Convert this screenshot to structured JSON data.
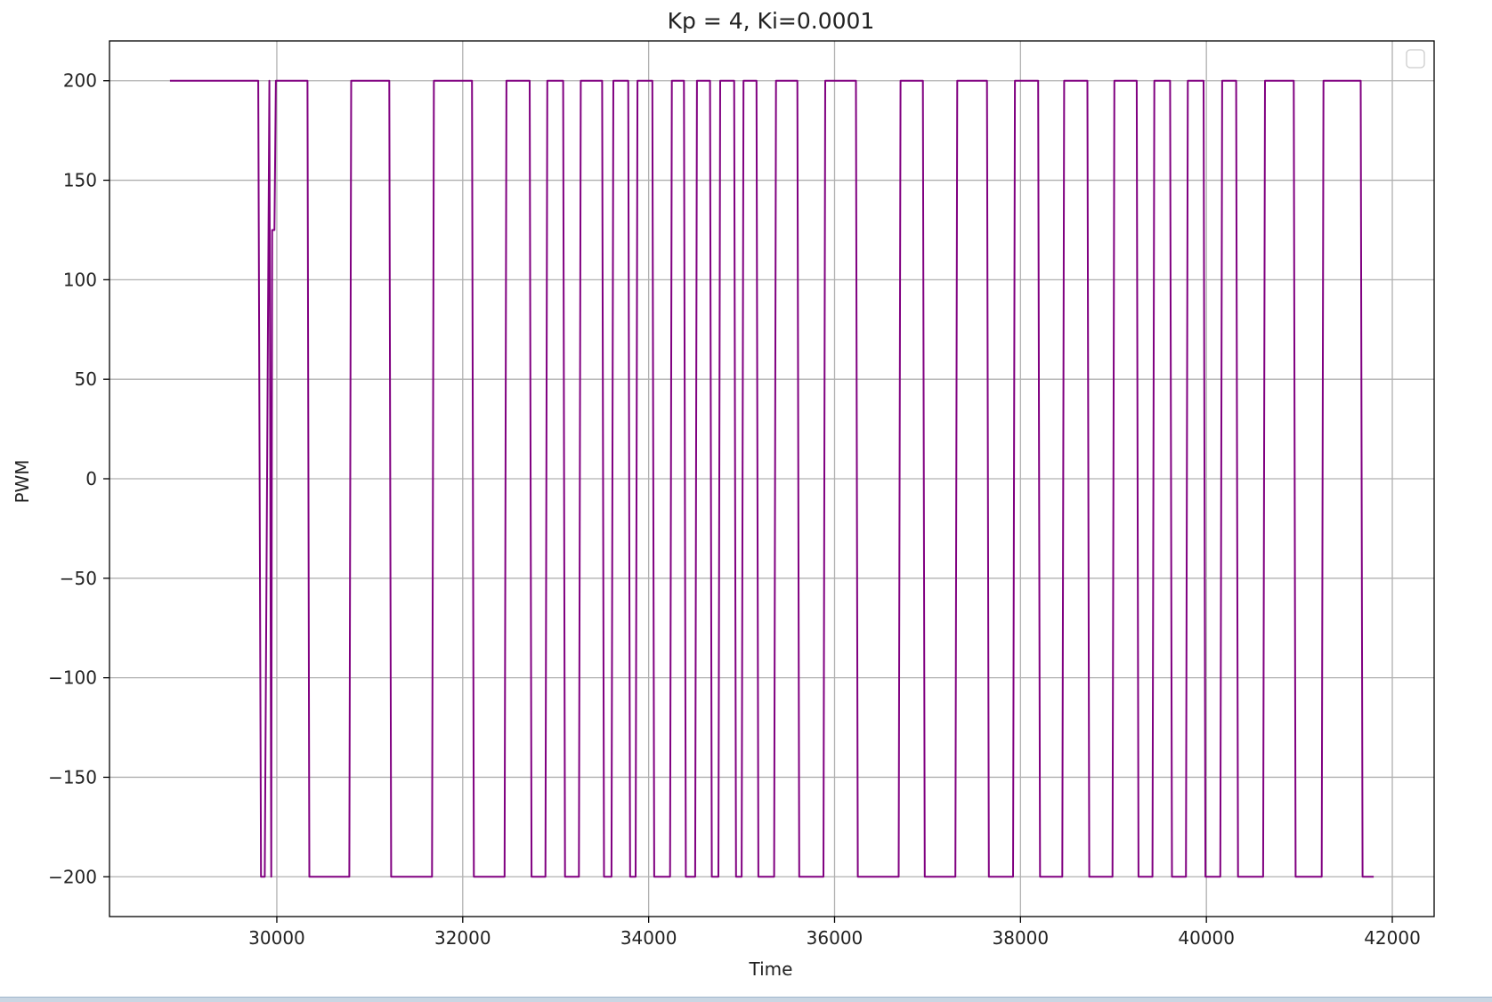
{
  "chart_data": {
    "type": "line",
    "title": "Kp = 4, Ki=0.0001",
    "xlabel": "Time",
    "ylabel": "PWM",
    "xlim": [
      28200,
      42450
    ],
    "ylim": [
      -220,
      220
    ],
    "xticks": [
      30000,
      32000,
      34000,
      36000,
      38000,
      40000,
      42000
    ],
    "yticks": [
      -200,
      -150,
      -100,
      -50,
      0,
      50,
      100,
      150,
      200
    ],
    "xtick_labels": [
      "30000",
      "32000",
      "34000",
      "36000",
      "38000",
      "40000",
      "42000"
    ],
    "ytick_labels": [
      "−200",
      "−150",
      "−100",
      "−50",
      "0",
      "50",
      "100",
      "150",
      "200"
    ],
    "grid": true,
    "legend": {
      "placement": "top-right",
      "entries": []
    },
    "series": [
      {
        "color": "#800080",
        "x": [
          28850,
          29800,
          29830,
          29870,
          29920,
          29940,
          29950,
          29975,
          29990,
          30000,
          30330,
          30350,
          30780,
          30800,
          31210,
          31230,
          31670,
          31690,
          32100,
          32120,
          32450,
          32470,
          32720,
          32740,
          32890,
          32910,
          33080,
          33100,
          33250,
          33270,
          33500,
          33520,
          33600,
          33620,
          33780,
          33800,
          33860,
          33880,
          34040,
          34060,
          34230,
          34250,
          34380,
          34400,
          34500,
          34520,
          34660,
          34680,
          34750,
          34770,
          34920,
          34940,
          35000,
          35020,
          35160,
          35180,
          35350,
          35370,
          35600,
          35620,
          35880,
          35900,
          36230,
          36250,
          36690,
          36710,
          36950,
          36970,
          37300,
          37320,
          37640,
          37660,
          37920,
          37940,
          38190,
          38210,
          38450,
          38470,
          38720,
          38740,
          38990,
          39010,
          39250,
          39270,
          39420,
          39440,
          39610,
          39630,
          39780,
          39800,
          39970,
          39990,
          40150,
          40170,
          40320,
          40340,
          40610,
          40630,
          40940,
          40960,
          41240,
          41260,
          41660,
          41680,
          41800
        ],
        "y": [
          200,
          200,
          -200,
          -200,
          200,
          -200,
          125,
          125,
          200,
          200,
          200,
          -200,
          -200,
          200,
          200,
          -200,
          -200,
          200,
          200,
          -200,
          -200,
          200,
          200,
          -200,
          -200,
          200,
          200,
          -200,
          -200,
          200,
          200,
          -200,
          -200,
          200,
          200,
          -200,
          -200,
          200,
          200,
          -200,
          -200,
          200,
          200,
          -200,
          -200,
          200,
          200,
          -200,
          -200,
          200,
          200,
          -200,
          -200,
          200,
          200,
          -200,
          -200,
          200,
          200,
          -200,
          -200,
          200,
          200,
          -200,
          -200,
          200,
          200,
          -200,
          -200,
          200,
          200,
          -200,
          -200,
          200,
          200,
          -200,
          -200,
          200,
          200,
          -200,
          -200,
          200,
          200,
          -200,
          -200,
          200,
          200,
          -200,
          -200,
          200,
          200,
          -200,
          -200,
          200,
          200,
          -200,
          -200,
          200,
          200,
          -200,
          -200,
          200,
          200,
          -200,
          -200
        ]
      }
    ]
  }
}
